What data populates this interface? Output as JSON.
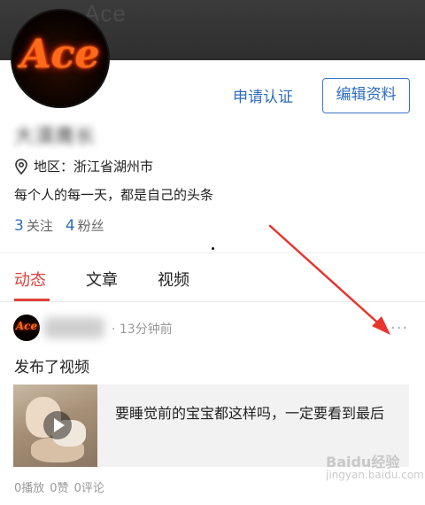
{
  "profile": {
    "username": "大漠鹰长",
    "apply_label": "申请认证",
    "edit_label": "编辑资料",
    "region": "地区：浙江省湖州市",
    "bio": "每个人的每一天，都是自己的头条",
    "following_count": "3",
    "following_label": "关注",
    "fans_count": "4",
    "fans_label": "粉丝",
    "avatar_text": "Ace"
  },
  "tabs": [
    {
      "label": "动态",
      "active": true
    },
    {
      "label": "文章",
      "active": false
    },
    {
      "label": "视频",
      "active": false
    }
  ],
  "post": {
    "avatar_text": "Ace",
    "time": "· 13分钟前",
    "more": "···",
    "text": "发布了视频",
    "video_title": "要睡觉前的宝宝都这样吗，一定要看到最后",
    "plays": "0播放",
    "likes": "0赞",
    "comments": "0评论"
  },
  "colors": {
    "accent_blue": "#2e6dbf",
    "active_red": "#e0403a",
    "annotation_arrow": "#e8352e"
  },
  "icons": {
    "location": "map-pin-icon",
    "more": "more-dots-icon",
    "play": "play-icon"
  }
}
